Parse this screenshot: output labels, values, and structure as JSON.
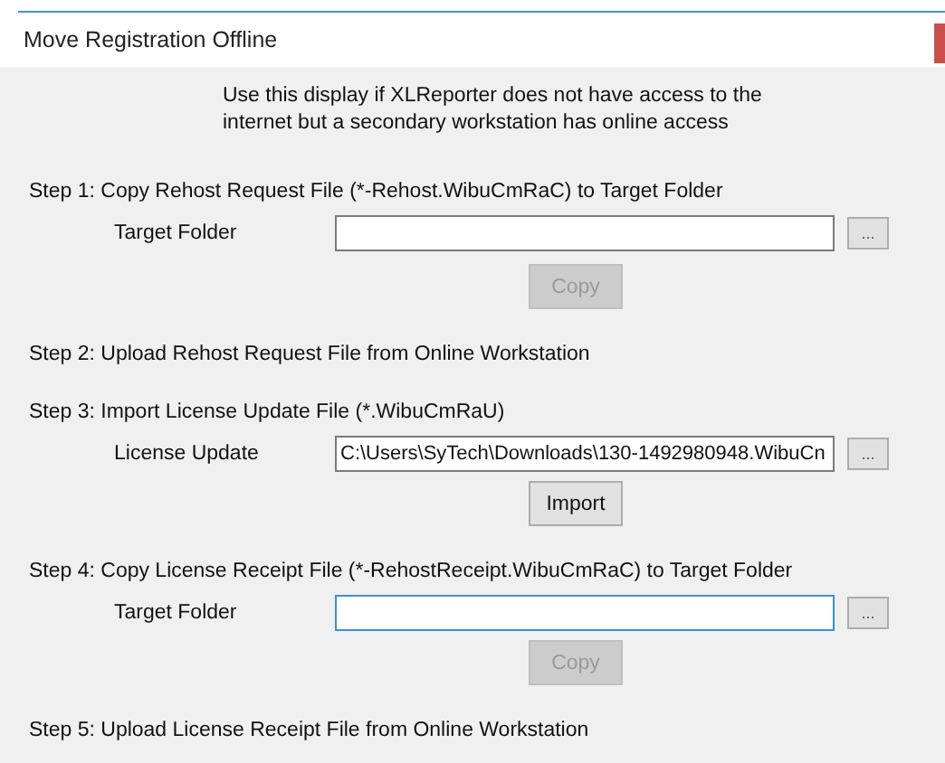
{
  "window": {
    "title": "Move Registration Offline"
  },
  "intro": "Use this display if XLReporter does not have access to the internet but a secondary workstation has online access",
  "steps": [
    {
      "heading": "Step 1: Copy Rehost Request File (*-Rehost.WibuCmRaC) to Target Folder",
      "field": {
        "label": "Target Folder",
        "focused": false,
        "browse": "..."
      },
      "button": {
        "label": "Copy",
        "disabled": true
      }
    },
    {
      "heading": "Step 2: Upload Rehost Request File from Online Workstation"
    },
    {
      "heading": "Step 3: Import License Update File (*.WibuCmRaU)",
      "field": {
        "label": "License Update",
        "value": "C:\\Users\\SyTech\\Downloads\\130-1492980948.WibuCn",
        "focused": false,
        "browse": "..."
      },
      "button": {
        "label": "Import",
        "disabled": false
      }
    },
    {
      "heading": "Step 4: Copy License Receipt File (*-RehostReceipt.WibuCmRaC) to Target Folder",
      "field": {
        "label": "Target Folder",
        "focused": true,
        "browse": "..."
      },
      "button": {
        "label": "Copy",
        "disabled": true
      }
    },
    {
      "heading": "Step 5: Upload License Receipt File from Online Workstation"
    }
  ]
}
